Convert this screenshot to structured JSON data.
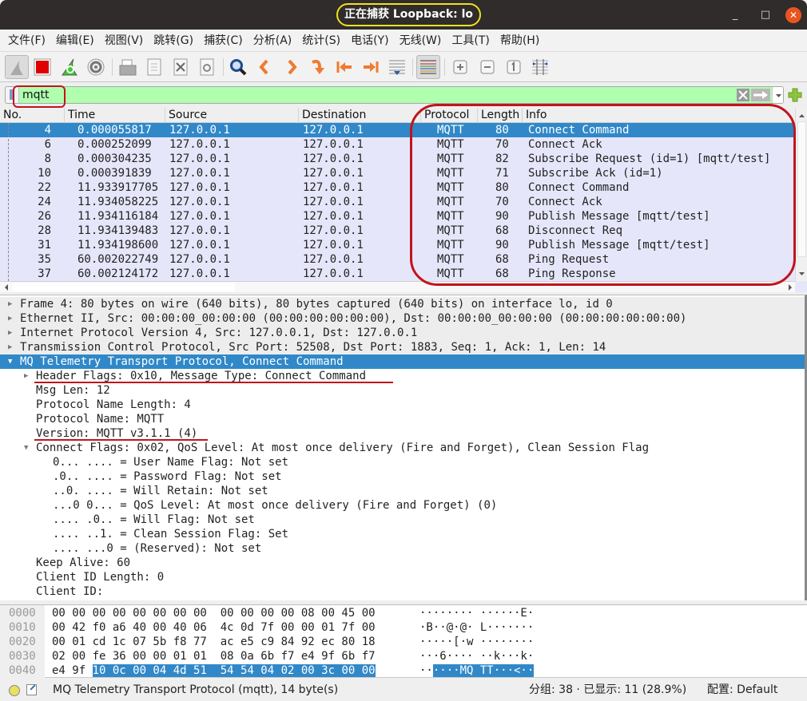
{
  "window": {
    "title": "正在捕获 Loopback: lo",
    "minimize_label": "_",
    "maximize_label": "□",
    "close_label": "✕"
  },
  "menu": [
    "文件(F)",
    "编辑(E)",
    "视图(V)",
    "跳转(G)",
    "捕获(C)",
    "分析(A)",
    "统计(S)",
    "电话(Y)",
    "无线(W)",
    "工具(T)",
    "帮助(H)"
  ],
  "toolbar": {
    "icons": [
      "shark-fin-start-icon",
      "stop-capture-icon",
      "restart-capture-icon",
      "capture-options-icon",
      "open-file-icon",
      "save-file-icon",
      "close-file-icon",
      "reload-file-icon",
      "find-packet-icon",
      "go-back-icon",
      "go-forward-icon",
      "go-to-packet-icon",
      "first-packet-icon",
      "last-packet-icon",
      "autoscroll-icon",
      "colorize-icon",
      "zoom-in-icon",
      "zoom-out-icon",
      "normal-size-icon",
      "resize-columns-icon"
    ]
  },
  "filter": {
    "value": "mqtt",
    "bg_color": "#afffaf"
  },
  "packet_list": {
    "columns": [
      "No.",
      "Time",
      "Source",
      "Destination",
      "Protocol",
      "Length",
      "Info"
    ],
    "selected_index": 0,
    "rows": [
      {
        "no": "4",
        "time": "0.000055817",
        "src": "127.0.0.1",
        "dst": "127.0.0.1",
        "proto": "MQTT",
        "len": "80",
        "info": "Connect Command"
      },
      {
        "no": "6",
        "time": "0.000252099",
        "src": "127.0.0.1",
        "dst": "127.0.0.1",
        "proto": "MQTT",
        "len": "70",
        "info": "Connect Ack"
      },
      {
        "no": "8",
        "time": "0.000304235",
        "src": "127.0.0.1",
        "dst": "127.0.0.1",
        "proto": "MQTT",
        "len": "82",
        "info": "Subscribe Request (id=1) [mqtt/test]"
      },
      {
        "no": "10",
        "time": "0.000391839",
        "src": "127.0.0.1",
        "dst": "127.0.0.1",
        "proto": "MQTT",
        "len": "71",
        "info": "Subscribe Ack (id=1)"
      },
      {
        "no": "22",
        "time": "11.933917705",
        "src": "127.0.0.1",
        "dst": "127.0.0.1",
        "proto": "MQTT",
        "len": "80",
        "info": "Connect Command"
      },
      {
        "no": "24",
        "time": "11.934058225",
        "src": "127.0.0.1",
        "dst": "127.0.0.1",
        "proto": "MQTT",
        "len": "70",
        "info": "Connect Ack"
      },
      {
        "no": "26",
        "time": "11.934116184",
        "src": "127.0.0.1",
        "dst": "127.0.0.1",
        "proto": "MQTT",
        "len": "90",
        "info": "Publish Message [mqtt/test]"
      },
      {
        "no": "28",
        "time": "11.934139483",
        "src": "127.0.0.1",
        "dst": "127.0.0.1",
        "proto": "MQTT",
        "len": "68",
        "info": "Disconnect Req"
      },
      {
        "no": "31",
        "time": "11.934198600",
        "src": "127.0.0.1",
        "dst": "127.0.0.1",
        "proto": "MQTT",
        "len": "90",
        "info": "Publish Message [mqtt/test]"
      },
      {
        "no": "35",
        "time": "60.002022749",
        "src": "127.0.0.1",
        "dst": "127.0.0.1",
        "proto": "MQTT",
        "len": "68",
        "info": "Ping Request"
      },
      {
        "no": "37",
        "time": "60.002124172",
        "src": "127.0.0.1",
        "dst": "127.0.0.1",
        "proto": "MQTT",
        "len": "68",
        "info": "Ping Response"
      }
    ]
  },
  "details": [
    {
      "indent": 0,
      "expander": "collapsed",
      "style": "grey",
      "text": "Frame 4: 80 bytes on wire (640 bits), 80 bytes captured (640 bits) on interface lo, id 0"
    },
    {
      "indent": 0,
      "expander": "collapsed",
      "style": "grey",
      "text": "Ethernet II, Src: 00:00:00_00:00:00 (00:00:00:00:00:00), Dst: 00:00:00_00:00:00 (00:00:00:00:00:00)"
    },
    {
      "indent": 0,
      "expander": "collapsed",
      "style": "grey",
      "text": "Internet Protocol Version 4, Src: 127.0.0.1, Dst: 127.0.0.1"
    },
    {
      "indent": 0,
      "expander": "collapsed",
      "style": "grey",
      "text": "Transmission Control Protocol, Src Port: 52508, Dst Port: 1883, Seq: 1, Ack: 1, Len: 14"
    },
    {
      "indent": 0,
      "expander": "expanded",
      "style": "sel",
      "text": "MQ Telemetry Transport Protocol, Connect Command"
    },
    {
      "indent": 1,
      "expander": "collapsed",
      "style": "",
      "text": "Header Flags: 0x10, Message Type: Connect Command",
      "underline": true
    },
    {
      "indent": 1,
      "expander": "",
      "style": "",
      "text": "Msg Len: 12"
    },
    {
      "indent": 1,
      "expander": "",
      "style": "",
      "text": "Protocol Name Length: 4"
    },
    {
      "indent": 1,
      "expander": "",
      "style": "",
      "text": "Protocol Name: MQTT"
    },
    {
      "indent": 1,
      "expander": "",
      "style": "",
      "text": "Version: MQTT v3.1.1 (4)",
      "underline": true
    },
    {
      "indent": 1,
      "expander": "expanded",
      "style": "",
      "text": "Connect Flags: 0x02, QoS Level: At most once delivery (Fire and Forget), Clean Session Flag"
    },
    {
      "indent": 2,
      "expander": "",
      "style": "",
      "text": "0... .... = User Name Flag: Not set"
    },
    {
      "indent": 2,
      "expander": "",
      "style": "",
      "text": ".0.. .... = Password Flag: Not set"
    },
    {
      "indent": 2,
      "expander": "",
      "style": "",
      "text": "..0. .... = Will Retain: Not set"
    },
    {
      "indent": 2,
      "expander": "",
      "style": "",
      "text": "...0 0... = QoS Level: At most once delivery (Fire and Forget) (0)"
    },
    {
      "indent": 2,
      "expander": "",
      "style": "",
      "text": ".... .0.. = Will Flag: Not set"
    },
    {
      "indent": 2,
      "expander": "",
      "style": "",
      "text": ".... ..1. = Clean Session Flag: Set"
    },
    {
      "indent": 2,
      "expander": "",
      "style": "",
      "text": ".... ...0 = (Reserved): Not set"
    },
    {
      "indent": 1,
      "expander": "",
      "style": "",
      "text": "Keep Alive: 60"
    },
    {
      "indent": 1,
      "expander": "",
      "style": "",
      "text": "Client ID Length: 0"
    },
    {
      "indent": 1,
      "expander": "",
      "style": "",
      "text": "Client ID:"
    }
  ],
  "hex": [
    {
      "offset": "0000",
      "bytes": "00 00 00 00 00 00 00 00  00 00 00 00 08 00 45 00",
      "ascii": "········ ······E·",
      "hl_bytes_from": -1,
      "hl_ascii_from": -1
    },
    {
      "offset": "0010",
      "bytes": "00 42 f0 a6 40 00 40 06  4c 0d 7f 00 00 01 7f 00",
      "ascii": "·B··@·@· L·······",
      "hl_bytes_from": -1,
      "hl_ascii_from": -1
    },
    {
      "offset": "0020",
      "bytes": "00 01 cd 1c 07 5b f8 77  ac e5 c9 84 92 ec 80 18",
      "ascii": "·····[·w ········",
      "hl_bytes_from": -1,
      "hl_ascii_from": -1
    },
    {
      "offset": "0030",
      "bytes": "02 00 fe 36 00 00 01 01  08 0a 6b f7 e4 9f 6b f7",
      "ascii": "···6···· ··k···k·",
      "hl_bytes_from": -1,
      "hl_ascii_from": -1
    },
    {
      "offset": "0040",
      "bytes": "e4 9f 10 0c 00 04 4d 51  54 54 04 02 00 3c 00 00",
      "ascii": "······MQ TT···<··",
      "hl_bytes_from": 6,
      "hl_ascii_from": 2
    }
  ],
  "status": {
    "left_text": "MQ Telemetry Transport Protocol (mqtt), 14 byte(s)",
    "packets_text": "分组: 38 · 已显示: 11 (28.9%)",
    "profile_text": "配置: Default"
  }
}
